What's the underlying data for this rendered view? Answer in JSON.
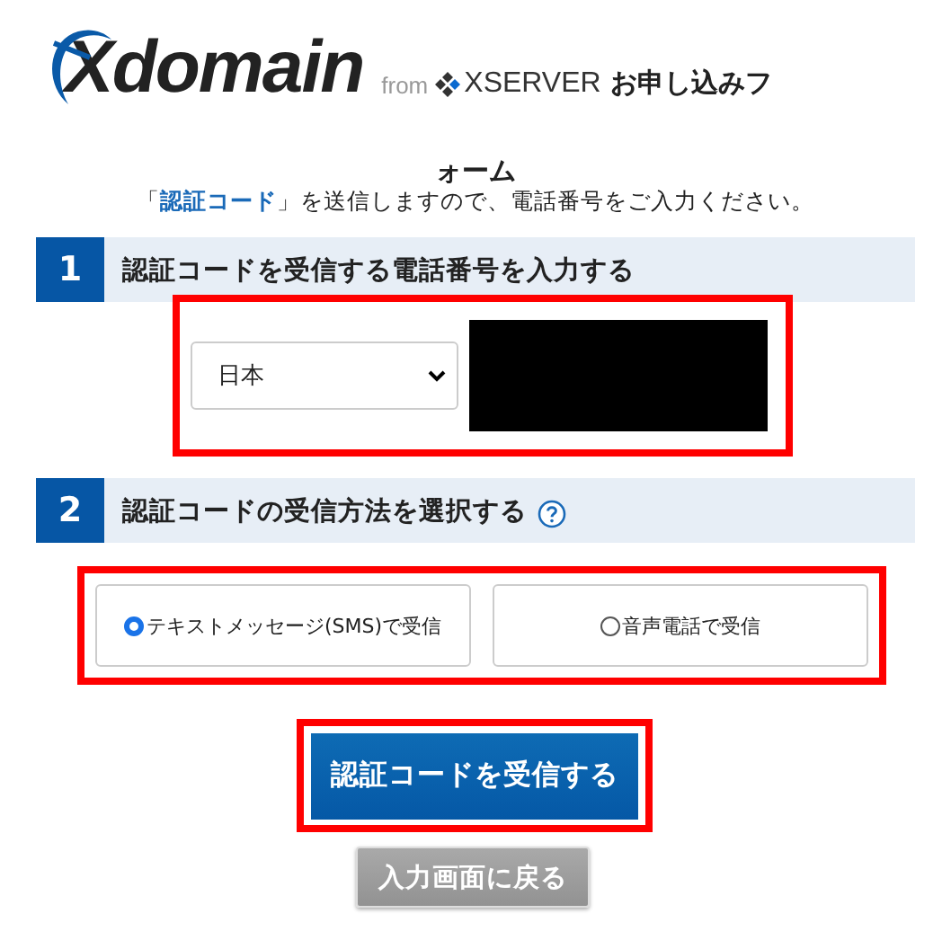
{
  "header": {
    "logo": "Xdomain",
    "from": "from",
    "brand": "XSERVER",
    "title_start": "お申し込みフ",
    "title_end": "ォーム"
  },
  "intro": "「**認証コード**」を送信しますので、電話番号をご入力ください。",
  "sections": [
    {
      "number": "1",
      "title": "認証コードを受信する電話番号を入力する",
      "help": false
    },
    {
      "number": "2",
      "title": "認証コードの受信方法を選択する",
      "help": true
    }
  ],
  "country": {
    "value": "日本"
  },
  "methods": [
    {
      "label": "テキストメッセージ(SMS)で受信",
      "selected": true
    },
    {
      "label": "音声電話で受信",
      "selected": false
    }
  ],
  "buttons": {
    "submit": "認証コードを受信する",
    "back": "入力画面に戻る"
  }
}
